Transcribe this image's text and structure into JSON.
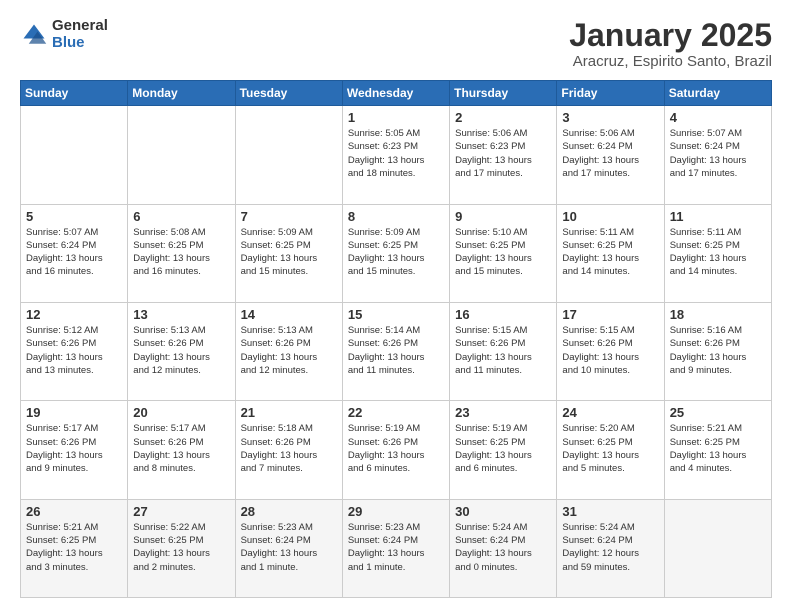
{
  "logo": {
    "general": "General",
    "blue": "Blue"
  },
  "header": {
    "title": "January 2025",
    "subtitle": "Aracruz, Espirito Santo, Brazil"
  },
  "weekdays": [
    "Sunday",
    "Monday",
    "Tuesday",
    "Wednesday",
    "Thursday",
    "Friday",
    "Saturday"
  ],
  "weeks": [
    [
      {
        "day": "",
        "info": ""
      },
      {
        "day": "",
        "info": ""
      },
      {
        "day": "",
        "info": ""
      },
      {
        "day": "1",
        "info": "Sunrise: 5:05 AM\nSunset: 6:23 PM\nDaylight: 13 hours\nand 18 minutes."
      },
      {
        "day": "2",
        "info": "Sunrise: 5:06 AM\nSunset: 6:23 PM\nDaylight: 13 hours\nand 17 minutes."
      },
      {
        "day": "3",
        "info": "Sunrise: 5:06 AM\nSunset: 6:24 PM\nDaylight: 13 hours\nand 17 minutes."
      },
      {
        "day": "4",
        "info": "Sunrise: 5:07 AM\nSunset: 6:24 PM\nDaylight: 13 hours\nand 17 minutes."
      }
    ],
    [
      {
        "day": "5",
        "info": "Sunrise: 5:07 AM\nSunset: 6:24 PM\nDaylight: 13 hours\nand 16 minutes."
      },
      {
        "day": "6",
        "info": "Sunrise: 5:08 AM\nSunset: 6:25 PM\nDaylight: 13 hours\nand 16 minutes."
      },
      {
        "day": "7",
        "info": "Sunrise: 5:09 AM\nSunset: 6:25 PM\nDaylight: 13 hours\nand 15 minutes."
      },
      {
        "day": "8",
        "info": "Sunrise: 5:09 AM\nSunset: 6:25 PM\nDaylight: 13 hours\nand 15 minutes."
      },
      {
        "day": "9",
        "info": "Sunrise: 5:10 AM\nSunset: 6:25 PM\nDaylight: 13 hours\nand 15 minutes."
      },
      {
        "day": "10",
        "info": "Sunrise: 5:11 AM\nSunset: 6:25 PM\nDaylight: 13 hours\nand 14 minutes."
      },
      {
        "day": "11",
        "info": "Sunrise: 5:11 AM\nSunset: 6:25 PM\nDaylight: 13 hours\nand 14 minutes."
      }
    ],
    [
      {
        "day": "12",
        "info": "Sunrise: 5:12 AM\nSunset: 6:26 PM\nDaylight: 13 hours\nand 13 minutes."
      },
      {
        "day": "13",
        "info": "Sunrise: 5:13 AM\nSunset: 6:26 PM\nDaylight: 13 hours\nand 12 minutes."
      },
      {
        "day": "14",
        "info": "Sunrise: 5:13 AM\nSunset: 6:26 PM\nDaylight: 13 hours\nand 12 minutes."
      },
      {
        "day": "15",
        "info": "Sunrise: 5:14 AM\nSunset: 6:26 PM\nDaylight: 13 hours\nand 11 minutes."
      },
      {
        "day": "16",
        "info": "Sunrise: 5:15 AM\nSunset: 6:26 PM\nDaylight: 13 hours\nand 11 minutes."
      },
      {
        "day": "17",
        "info": "Sunrise: 5:15 AM\nSunset: 6:26 PM\nDaylight: 13 hours\nand 10 minutes."
      },
      {
        "day": "18",
        "info": "Sunrise: 5:16 AM\nSunset: 6:26 PM\nDaylight: 13 hours\nand 9 minutes."
      }
    ],
    [
      {
        "day": "19",
        "info": "Sunrise: 5:17 AM\nSunset: 6:26 PM\nDaylight: 13 hours\nand 9 minutes."
      },
      {
        "day": "20",
        "info": "Sunrise: 5:17 AM\nSunset: 6:26 PM\nDaylight: 13 hours\nand 8 minutes."
      },
      {
        "day": "21",
        "info": "Sunrise: 5:18 AM\nSunset: 6:26 PM\nDaylight: 13 hours\nand 7 minutes."
      },
      {
        "day": "22",
        "info": "Sunrise: 5:19 AM\nSunset: 6:26 PM\nDaylight: 13 hours\nand 6 minutes."
      },
      {
        "day": "23",
        "info": "Sunrise: 5:19 AM\nSunset: 6:25 PM\nDaylight: 13 hours\nand 6 minutes."
      },
      {
        "day": "24",
        "info": "Sunrise: 5:20 AM\nSunset: 6:25 PM\nDaylight: 13 hours\nand 5 minutes."
      },
      {
        "day": "25",
        "info": "Sunrise: 5:21 AM\nSunset: 6:25 PM\nDaylight: 13 hours\nand 4 minutes."
      }
    ],
    [
      {
        "day": "26",
        "info": "Sunrise: 5:21 AM\nSunset: 6:25 PM\nDaylight: 13 hours\nand 3 minutes."
      },
      {
        "day": "27",
        "info": "Sunrise: 5:22 AM\nSunset: 6:25 PM\nDaylight: 13 hours\nand 2 minutes."
      },
      {
        "day": "28",
        "info": "Sunrise: 5:23 AM\nSunset: 6:24 PM\nDaylight: 13 hours\nand 1 minute."
      },
      {
        "day": "29",
        "info": "Sunrise: 5:23 AM\nSunset: 6:24 PM\nDaylight: 13 hours\nand 1 minute."
      },
      {
        "day": "30",
        "info": "Sunrise: 5:24 AM\nSunset: 6:24 PM\nDaylight: 13 hours\nand 0 minutes."
      },
      {
        "day": "31",
        "info": "Sunrise: 5:24 AM\nSunset: 6:24 PM\nDaylight: 12 hours\nand 59 minutes."
      },
      {
        "day": "",
        "info": ""
      }
    ]
  ]
}
